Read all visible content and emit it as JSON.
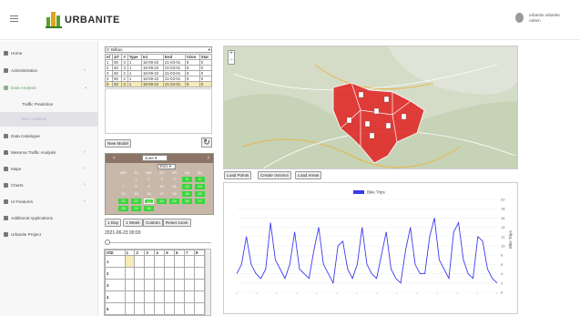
{
  "header": {
    "brand": "URBANITE",
    "user_name": "urbanite urbanite",
    "user_role": "Admin"
  },
  "sidebar": {
    "items": [
      {
        "label": "Home"
      },
      {
        "label": "Administration"
      },
      {
        "label": "Data Analysis"
      },
      {
        "label": "Traffic Prediction"
      },
      {
        "label": "Bike Analysis"
      },
      {
        "label": "Data Catalogue"
      },
      {
        "label": "Mesoma Traffic Analysis"
      },
      {
        "label": "Maps"
      },
      {
        "label": "Charts"
      },
      {
        "label": "UI Features"
      },
      {
        "label": "Additional Applications"
      },
      {
        "label": "Urbanite Project"
      }
    ]
  },
  "model_table": {
    "selector": "0: Bilbao",
    "columns": [
      "Id",
      "ΔT",
      "#",
      "Type",
      "Ini",
      "End",
      "#Zon",
      "Stat"
    ],
    "rows": [
      [
        "1",
        "60",
        "3",
        "1",
        "18-09-22",
        "21-03-01",
        "8",
        "0"
      ],
      [
        "2",
        "60",
        "3",
        "1",
        "18-09-22",
        "21-03-01",
        "8",
        "0"
      ],
      [
        "3",
        "60",
        "2",
        "1",
        "18-09-22",
        "21-03-01",
        "8",
        "0"
      ],
      [
        "4",
        "60",
        "2",
        "1",
        "18-09-22",
        "21-03-01",
        "8",
        "0"
      ],
      [
        "5",
        "60",
        "3",
        "1",
        "18-09-22",
        "21-03-01",
        "8",
        "0"
      ]
    ],
    "new_model": "New Model"
  },
  "calendar": {
    "month": "June",
    "year": "2021",
    "weekdays": [
      "MO",
      "TU",
      "WE",
      "TH",
      "FR",
      "SA",
      "SU"
    ],
    "days": [
      [
        "",
        "1",
        "2",
        "3",
        "4",
        "5",
        "6"
      ],
      [
        "7",
        "8",
        "9",
        "10",
        "11",
        "12",
        "13"
      ],
      [
        "14",
        "15",
        "16",
        "17",
        "18",
        "19",
        "20"
      ],
      [
        "21",
        "22",
        "23",
        "24",
        "25",
        "26",
        "27"
      ],
      [
        "28",
        "29",
        "30",
        "",
        "",
        "",
        ""
      ]
    ]
  },
  "range_buttons": [
    "1 Day",
    "1 Week",
    "Custom",
    "Reset zoom"
  ],
  "timestamp": "2021-06-23 00:00",
  "od_table": {
    "header": [
      "O\\D",
      "1",
      "2",
      "3",
      "4",
      "5",
      "6",
      "7",
      "8"
    ],
    "rows": [
      "1",
      "2",
      "3",
      "4",
      "5"
    ]
  },
  "map_buttons": [
    "Load Points",
    "Create Voronoi",
    "Load Areas"
  ],
  "chart_data": {
    "type": "line",
    "title": "",
    "legend": [
      "Bike Trips"
    ],
    "ylim": [
      0,
      20
    ],
    "xlabel": "",
    "ylabel": "Bike Trips",
    "yticks": [
      0,
      2,
      4,
      6,
      8,
      10,
      12,
      14,
      16,
      18,
      20
    ],
    "series": [
      {
        "name": "Bike Trips",
        "values": [
          4,
          6,
          12,
          6,
          4,
          3,
          5,
          15,
          7,
          5,
          3,
          6,
          13,
          5,
          4,
          3,
          9,
          14,
          6,
          4,
          2,
          10,
          11,
          5,
          3,
          6,
          14,
          6,
          4,
          3,
          8,
          13,
          5,
          3,
          2,
          9,
          14,
          6,
          4,
          4,
          12,
          16,
          7,
          5,
          3,
          13,
          15,
          7,
          4,
          3,
          12,
          11,
          5,
          3,
          2
        ]
      }
    ],
    "color": "#3a3af0"
  },
  "colors": {
    "accent": "#3cd63c",
    "zone": "#e02020",
    "line": "#3a3af0"
  }
}
